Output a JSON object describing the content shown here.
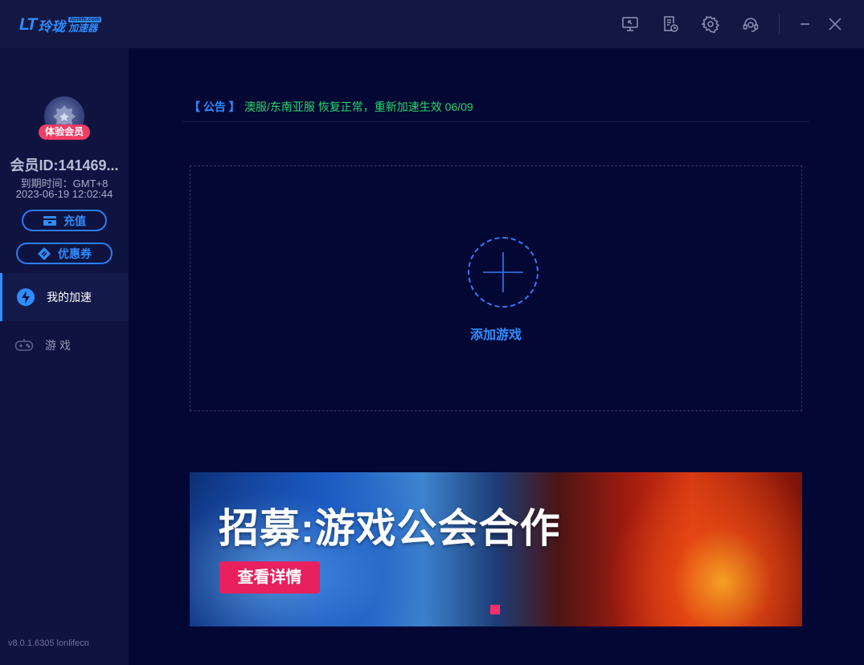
{
  "app": {
    "logo_mark": "LT",
    "logo_name": "玲珑",
    "logo_en": "lonlife.com",
    "logo_sub": "加速器"
  },
  "titlebar": {
    "icons": [
      "screen-share-icon",
      "log-icon",
      "gear-icon",
      "headset-icon",
      "minimize-icon",
      "close-icon"
    ]
  },
  "user": {
    "badge": "体验会员",
    "member_id": "会员ID:141469...",
    "expire_label": "到期时间：GMT+8",
    "expire_time": "2023-06-19 12:02:44",
    "recharge_label": "充值",
    "coupon_label": "优惠券"
  },
  "nav": {
    "items": [
      {
        "label": "我的加速",
        "icon": "lightning-icon",
        "active": true
      },
      {
        "label": "游 戏",
        "icon": "gamepad-icon",
        "active": false
      }
    ]
  },
  "version": "v8.0.1.6305 lonlifecn",
  "notice": {
    "tag": "【 公告 】",
    "message": "澳服/东南亚服 恢复正常，重新加速生效 06/09"
  },
  "add_game": {
    "label": "添加游戏"
  },
  "banner": {
    "title": "招募:游戏公会合作",
    "button": "查看详情"
  },
  "colors": {
    "accent": "#2f8dff",
    "notice_text": "#23d86b",
    "badge": "#ef3e64",
    "banner_button": "#e8205d",
    "background": "#020734",
    "sidebar": "#0e1340"
  }
}
